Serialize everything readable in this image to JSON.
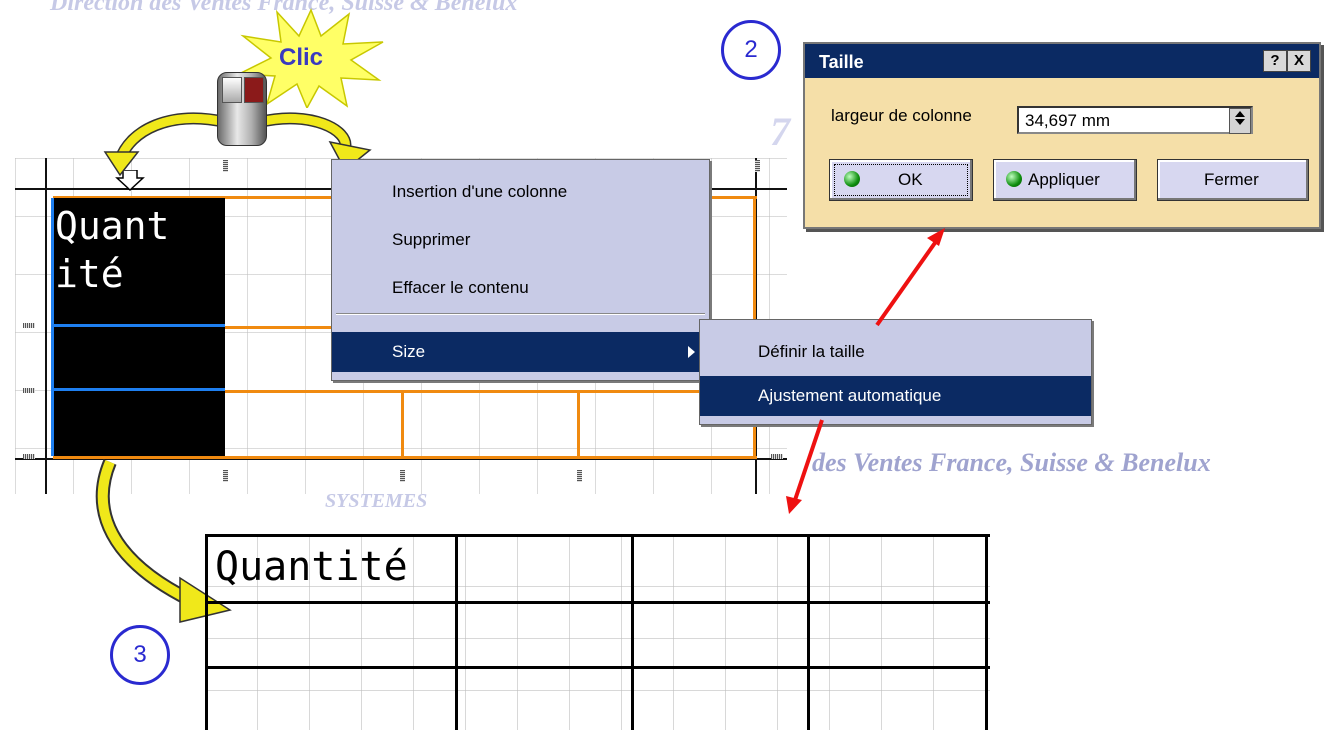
{
  "watermark": {
    "top_text": "Direction des Ventes France, Suisse & Benelux",
    "middle_text": "des Ventes France, Suisse & Benelux",
    "systemes_text": "SYSTEMES",
    "seven_text": "7"
  },
  "callout": {
    "clic_label": "Clic",
    "step2_label": "2",
    "step3_label": "3"
  },
  "editor": {
    "column_header": "Quant\nité"
  },
  "context_menu": {
    "insert_column": "Insertion d'une colonne",
    "delete": "Supprimer",
    "clear_content": "Effacer le contenu",
    "size": "Size"
  },
  "submenu": {
    "define_size": "Définir la taille",
    "auto_fit": "Ajustement automatique"
  },
  "dialog": {
    "title": "Taille",
    "help_btn": "?",
    "close_btn": "X",
    "field_label": "largeur de colonne",
    "field_value": "34,697 mm",
    "ok_label": "OK",
    "apply_label": "Appliquer",
    "close_label": "Fermer"
  },
  "result": {
    "column_header": "Quantité"
  },
  "colors": {
    "menu_bg": "#c8cbe6",
    "selected_bg": "#0b2a63",
    "dialog_bg": "#f5dfa8",
    "callout_blue": "#2a2ad0",
    "arrow_red": "#ee1111",
    "arrow_yellow": "#f0e81a"
  }
}
